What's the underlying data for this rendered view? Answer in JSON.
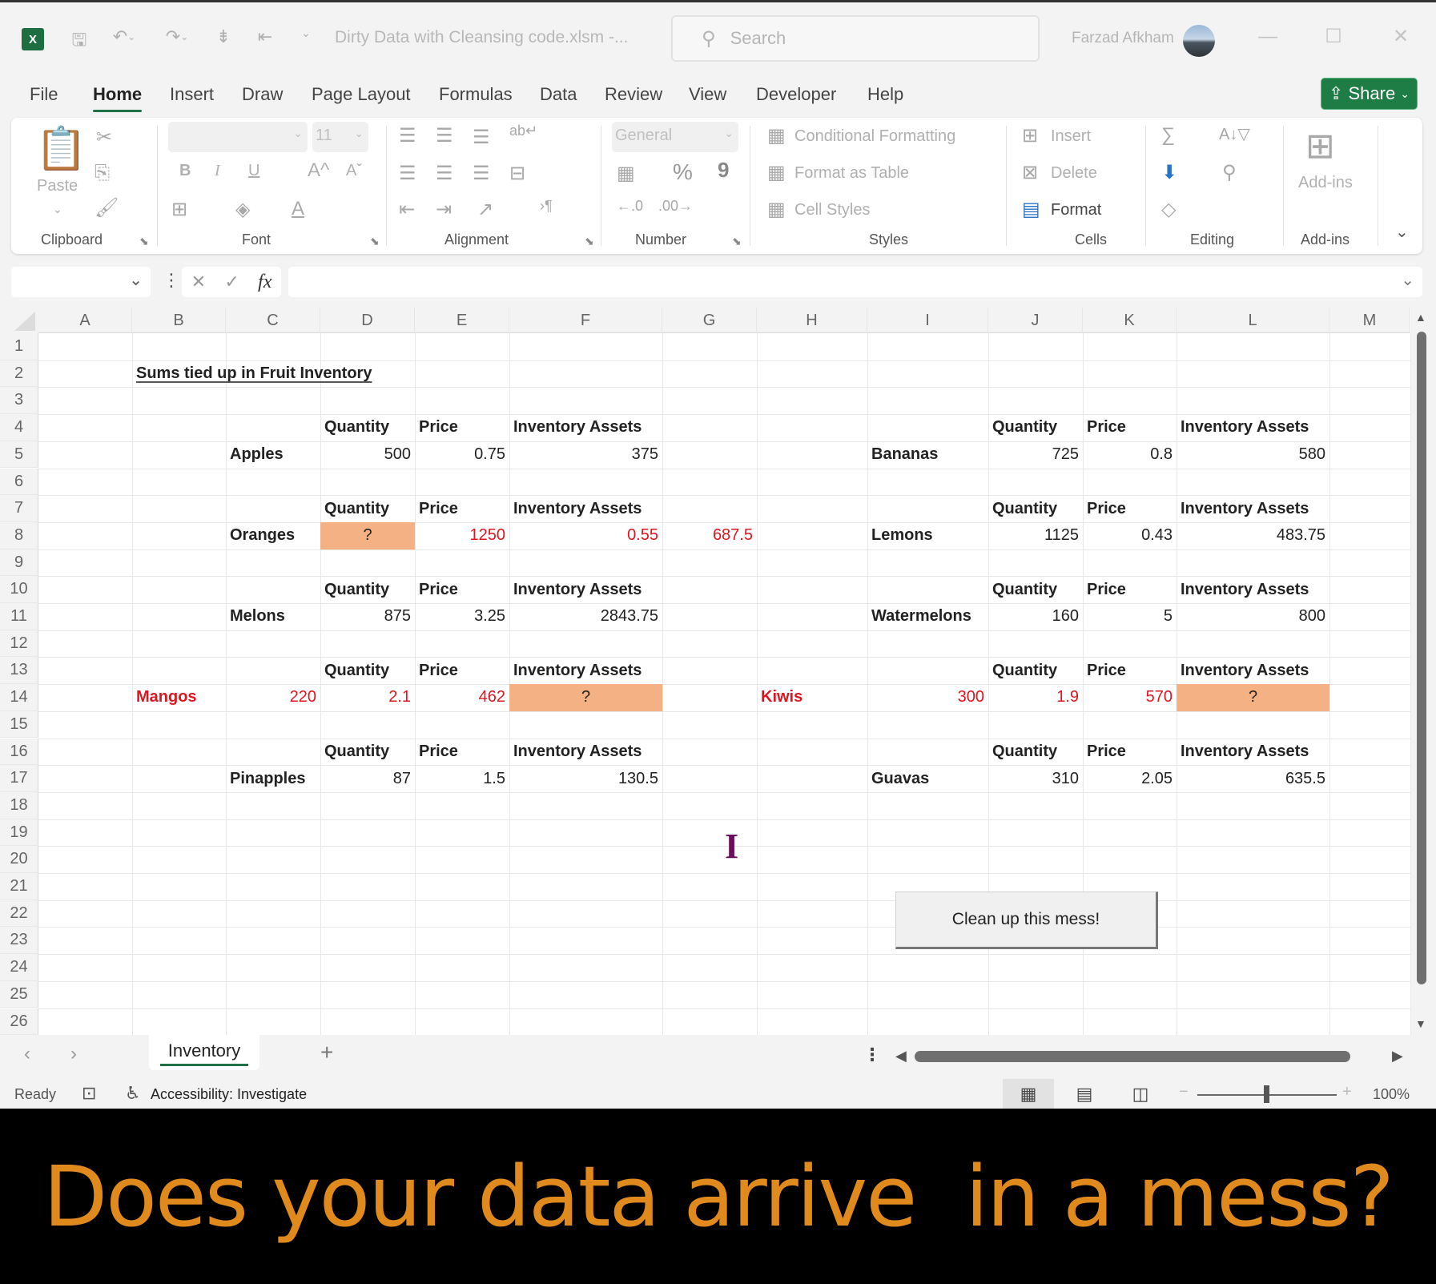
{
  "window": {
    "app_icon": "excel-icon",
    "document_title": "Dirty Data with Cleansing code.xlsm  -...",
    "search_placeholder": "Search",
    "user_name": "Farzad Afkham",
    "controls": {
      "minimize": "—",
      "maximize": "☐",
      "close": "✕"
    }
  },
  "quick_access": {
    "save": "save-icon",
    "undo": "undo-icon",
    "redo": "redo-icon",
    "touch_mode": "touch-mode-icon",
    "merge": "merge-icon",
    "customize": "customize-icon"
  },
  "menu": {
    "tabs": [
      "File",
      "Home",
      "Insert",
      "Draw",
      "Page Layout",
      "Formulas",
      "Data",
      "Review",
      "View",
      "Developer",
      "Help"
    ],
    "active": "Home",
    "share_label": "Share"
  },
  "ribbon": {
    "groups": {
      "clipboard": {
        "label": "Clipboard",
        "paste": "Paste"
      },
      "font": {
        "label": "Font",
        "font_name": "",
        "font_size": "11",
        "bold": "B",
        "italic": "I",
        "underline": "U",
        "grow": "A^",
        "shrink": "Aˇ"
      },
      "alignment": {
        "label": "Alignment"
      },
      "number": {
        "label": "Number",
        "format": "General",
        "percent": "%",
        "comma": "9"
      },
      "styles": {
        "label": "Styles",
        "conditional_formatting": "Conditional Formatting",
        "format_as_table": "Format as Table",
        "cell_styles": "Cell Styles"
      },
      "cells": {
        "label": "Cells",
        "insert": "Insert",
        "delete": "Delete",
        "format": "Format"
      },
      "editing": {
        "label": "Editing"
      },
      "addins": {
        "label": "Add-ins",
        "button": "Add-ins"
      }
    }
  },
  "formula_bar": {
    "name_box": "",
    "formula": "",
    "fx": "fx"
  },
  "sheet": {
    "columns": [
      "A",
      "B",
      "C",
      "D",
      "E",
      "F",
      "G",
      "H",
      "I",
      "J",
      "K",
      "L",
      "M"
    ],
    "rows": [
      "1",
      "2",
      "3",
      "4",
      "5",
      "6",
      "7",
      "8",
      "9",
      "10",
      "11",
      "12",
      "13",
      "14",
      "15",
      "16",
      "17",
      "18",
      "19",
      "20",
      "21",
      "22",
      "23",
      "24",
      "25",
      "26"
    ],
    "title": "Sums tied up in Fruit Inventory",
    "header_labels": {
      "quantity": "Quantity",
      "price": "Price",
      "assets": "Inventory Assets"
    },
    "left_blocks": [
      {
        "fruit": "Apples",
        "quantity": "500",
        "price": "0.75",
        "assets": "375"
      },
      {
        "fruit": "Oranges",
        "quantity": "?",
        "price": "1250",
        "assets": "0.55",
        "extra": "687.5"
      },
      {
        "fruit": "Melons",
        "quantity": "875",
        "price": "3.25",
        "assets": "2843.75"
      },
      {
        "fruit": "Mangos",
        "quantity": "220",
        "price": "2.1",
        "assets": "462",
        "extra": "?"
      },
      {
        "fruit": "Pinapples",
        "quantity": "87",
        "price": "1.5",
        "assets": "130.5"
      }
    ],
    "right_blocks": [
      {
        "fruit": "Bananas",
        "quantity": "725",
        "price": "0.8",
        "assets": "580"
      },
      {
        "fruit": "Lemons",
        "quantity": "1125",
        "price": "0.43",
        "assets": "483.75"
      },
      {
        "fruit": "Watermelons",
        "quantity": "160",
        "price": "5",
        "assets": "800"
      },
      {
        "fruit": "Kiwis",
        "quantity": "300",
        "price": "1.9",
        "assets": "570",
        "extra": "?"
      },
      {
        "fruit": "Guavas",
        "quantity": "310",
        "price": "2.05",
        "assets": "635.5"
      }
    ],
    "macro_button": "Clean up this mess!",
    "colors": {
      "highlight_fill": "#f4b183",
      "error_text": "#e0151f"
    }
  },
  "sheet_tabs": {
    "tabs": [
      "Inventory"
    ],
    "active": "Inventory",
    "add": "+"
  },
  "status_bar": {
    "ready": "Ready",
    "accessibility": "Accessibility: Investigate",
    "zoom": "100%",
    "zoom_percent": 100
  },
  "caption": "Does your data arrive  in a mess?"
}
